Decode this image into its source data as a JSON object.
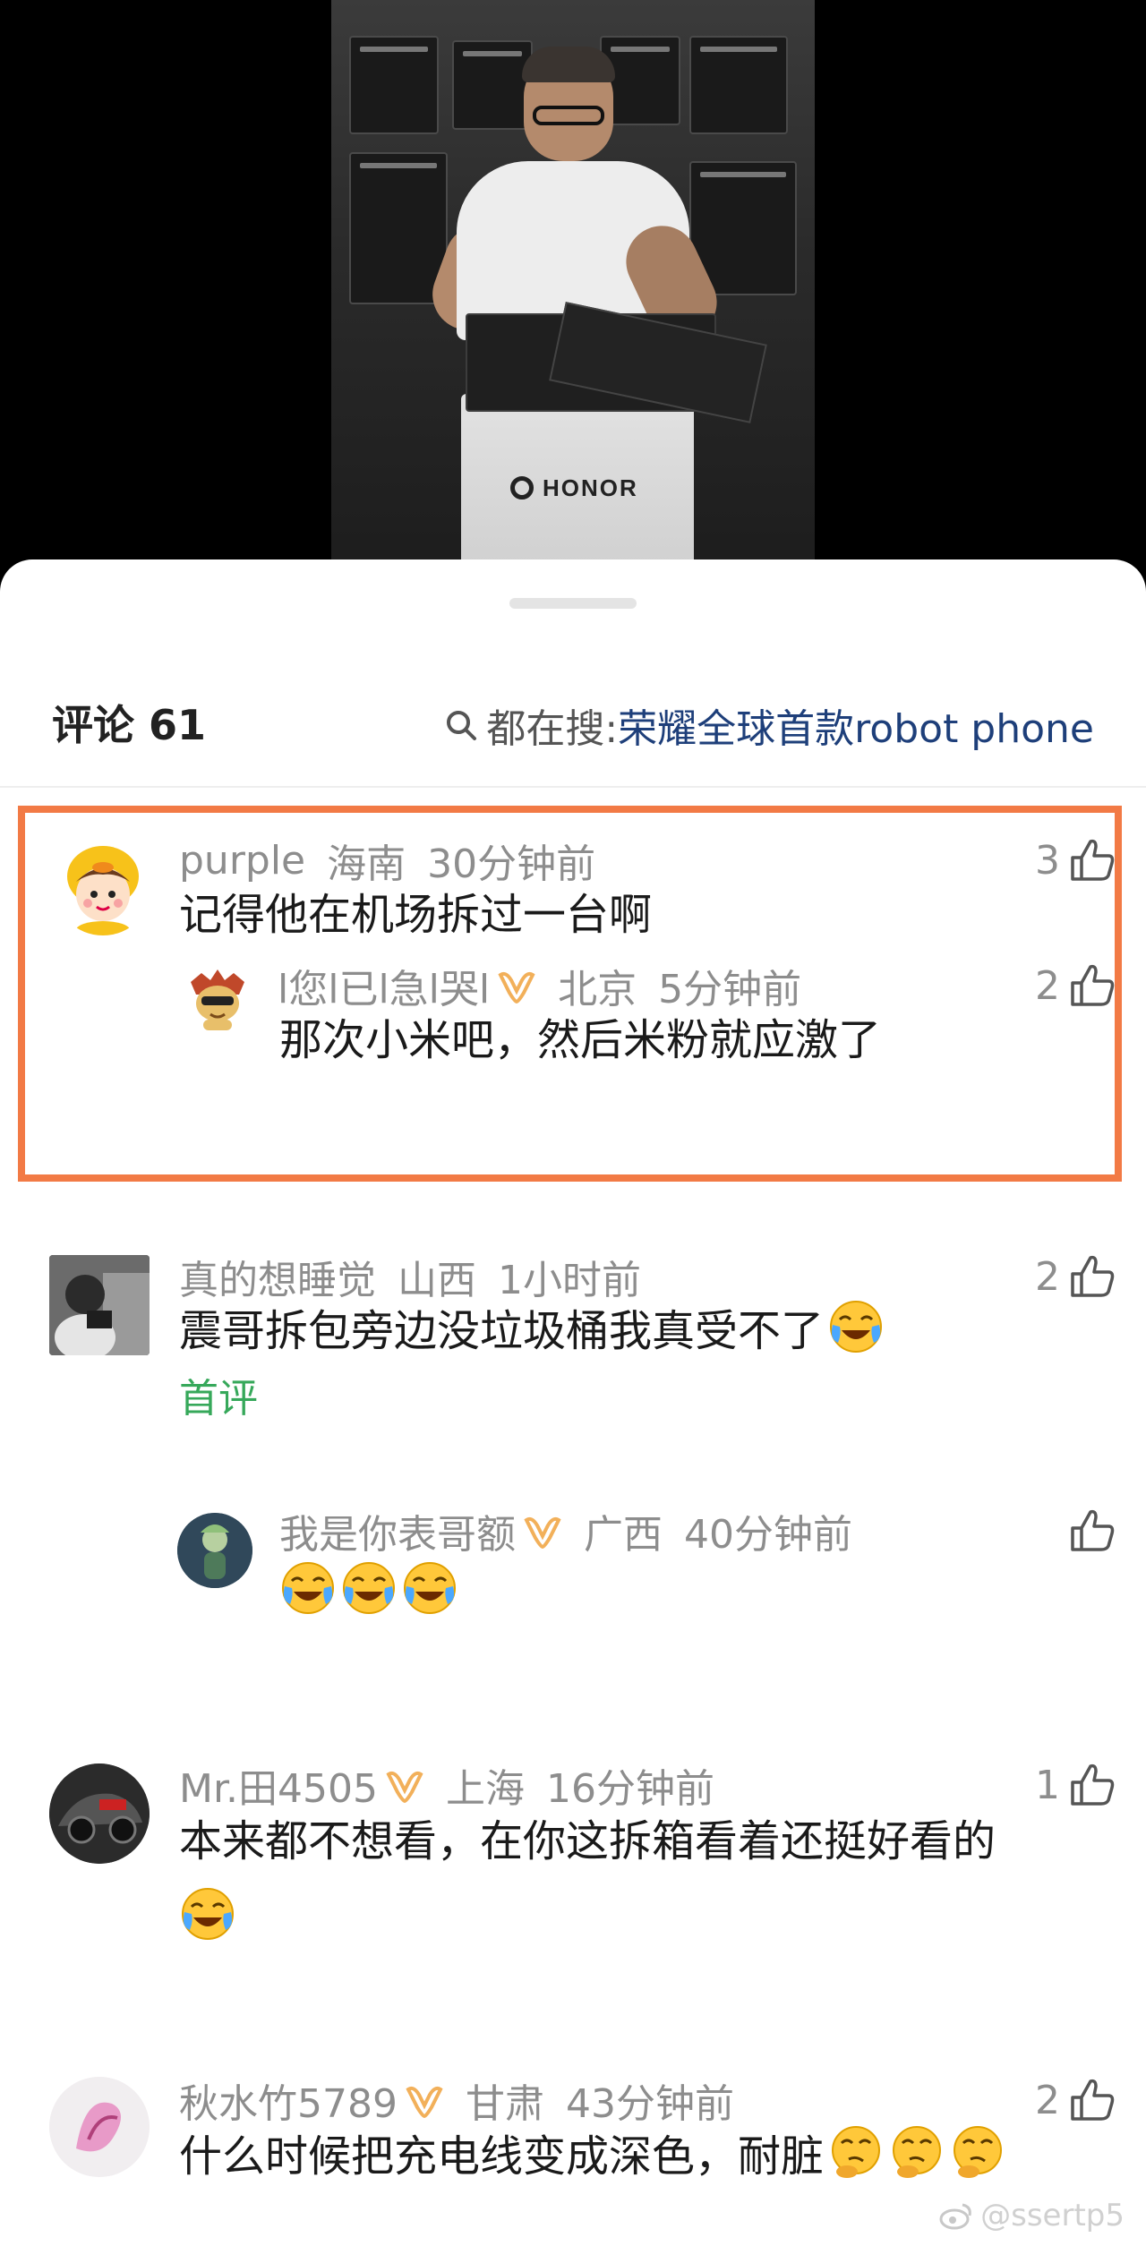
{
  "video": {
    "brand_text": "HONOR"
  },
  "header": {
    "comments_label": "评论 61",
    "search_prefix": "都在搜: ",
    "search_term": "荣耀全球首款robot phone"
  },
  "comments": [
    {
      "name": "purple",
      "location": "海南",
      "time": "30分钟前",
      "likes": "3",
      "text": "记得他在机场拆过一台啊",
      "vip": false,
      "reply": {
        "name": "l您l已l急l哭l",
        "location": "北京",
        "time": "5分钟前",
        "likes": "2",
        "text": "那次小米吧，然后米粉就应激了",
        "vip": true
      }
    },
    {
      "name": "真的想睡觉",
      "location": "山西",
      "time": "1小时前",
      "likes": "2",
      "text": "震哥拆包旁边没垃圾桶我真受不了",
      "tag": "首评",
      "vip": false,
      "reply": {
        "name": "我是你表哥额",
        "location": "广西",
        "time": "40分钟前",
        "likes": "",
        "text": "",
        "vip": true,
        "emoji_count": 3
      }
    },
    {
      "name": "Mr.田4505",
      "location": "上海",
      "time": "16分钟前",
      "likes": "1",
      "text": "本来都不想看，在你这拆箱看着还挺好看的",
      "vip": true
    },
    {
      "name": "秋水竹5789",
      "location": "甘肃",
      "time": "43分钟前",
      "likes": "2",
      "text": "什么时候把充电线变成深色，耐脏",
      "vip": true
    }
  ],
  "watermark": "@ssertp5",
  "colors": {
    "highlight": "#f27a45",
    "search_term": "#1e3f7a",
    "first_tag": "#36a85a",
    "meta": "#8d8d8d",
    "vip_gold": "#f2b05a"
  }
}
